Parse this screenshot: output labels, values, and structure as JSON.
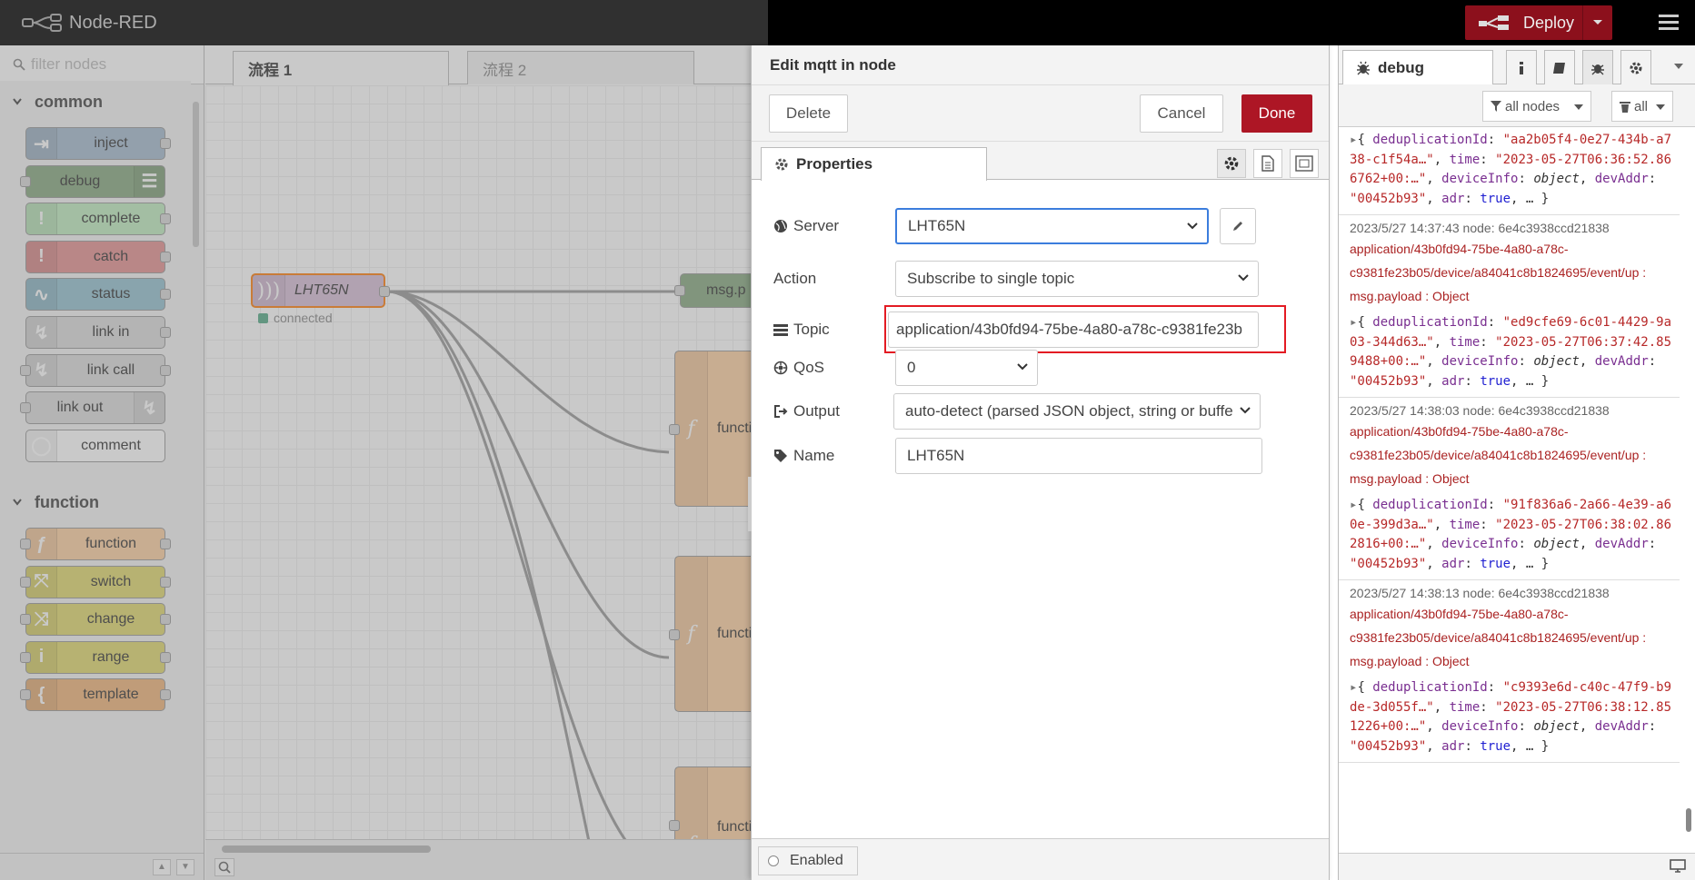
{
  "app": {
    "title": "Node-RED"
  },
  "header": {
    "deploy_label": "Deploy"
  },
  "palette": {
    "filter_placeholder": "filter nodes",
    "categories": [
      {
        "name": "common",
        "nodes": [
          {
            "label": "inject",
            "color": "#a6bbcf"
          },
          {
            "label": "debug",
            "color": "#87a980"
          },
          {
            "label": "complete",
            "color": "#c0edc0"
          },
          {
            "label": "catch",
            "color": "#e49191"
          },
          {
            "label": "status",
            "color": "#94c1d0"
          },
          {
            "label": "link in",
            "color": "#dddddd"
          },
          {
            "label": "link call",
            "color": "#dddddd"
          },
          {
            "label": "link out",
            "color": "#dddddd"
          },
          {
            "label": "comment",
            "color": "#ffffff"
          }
        ]
      },
      {
        "name": "function",
        "nodes": [
          {
            "label": "function",
            "color": "#fdd0a2"
          },
          {
            "label": "switch",
            "color": "#e2d96e"
          },
          {
            "label": "change",
            "color": "#e2d96e"
          },
          {
            "label": "range",
            "color": "#e2d96e"
          },
          {
            "label": "template",
            "color": "#f0b57b"
          }
        ]
      }
    ]
  },
  "workspace": {
    "tabs": [
      {
        "label": "流程 1",
        "active": true
      },
      {
        "label": "流程 2",
        "active": false
      }
    ],
    "nodes": {
      "mqtt_in": {
        "label": "LHT65N",
        "status": "connected",
        "color": "#d8bfd8"
      },
      "debug": {
        "label": "msg.p"
      },
      "functions": [
        {
          "label": "functi"
        },
        {
          "label": "functi"
        },
        {
          "label": "functi"
        }
      ]
    }
  },
  "editor": {
    "title": "Edit mqtt in node",
    "buttons": {
      "delete": "Delete",
      "cancel": "Cancel",
      "done": "Done"
    },
    "tab_properties": "Properties",
    "fields": {
      "server": {
        "label": "Server",
        "value": "LHT65N"
      },
      "action": {
        "label": "Action",
        "value": "Subscribe to single topic"
      },
      "topic": {
        "label": "Topic",
        "value": "application/43b0fd94-75be-4a80-a78c-c9381fe23b"
      },
      "qos": {
        "label": "QoS",
        "value": "0"
      },
      "output": {
        "label": "Output",
        "value": "auto-detect (parsed JSON object, string or buffe"
      },
      "name": {
        "label": "Name",
        "value": "LHT65N"
      }
    },
    "enabled_label": "Enabled",
    "highlight_color": "#e31b23"
  },
  "sidebar": {
    "tab_label": "debug",
    "filter_nodes_label": "all nodes",
    "clear_label": "all",
    "messages": [
      {
        "meta": "",
        "topic_lines": [],
        "payload": "",
        "obj": [
          {
            "k": "deduplicationId",
            "v": "\"aa2b05f4-0e27-434b-a738-c1f54a…\""
          },
          {
            "k": "time",
            "v": "\"2023-05-27T06:36:52.866762+00:…\""
          },
          {
            "k": "deviceInfo",
            "v": "object",
            "type": "i"
          },
          {
            "k": "devAddr",
            "v": "\"00452b93\""
          },
          {
            "k": "adr",
            "v": "true",
            "type": "b"
          }
        ]
      },
      {
        "meta": "2023/5/27 14:37:43   node: 6e4c3938ccd21838",
        "topic_lines": [
          "application/43b0fd94-75be-4a80-a78c-",
          "c9381fe23b05/device/a84041c8b1824695/event/up :",
          "msg.payload : Object"
        ],
        "obj": [
          {
            "k": "deduplicationId",
            "v": "\"ed9cfe69-6c01-4429-9a03-344d63…\""
          },
          {
            "k": "time",
            "v": "\"2023-05-27T06:37:42.859488+00:…\""
          },
          {
            "k": "deviceInfo",
            "v": "object",
            "type": "i"
          },
          {
            "k": "devAddr",
            "v": "\"00452b93\""
          },
          {
            "k": "adr",
            "v": "true",
            "type": "b"
          }
        ]
      },
      {
        "meta": "2023/5/27 14:38:03   node: 6e4c3938ccd21838",
        "topic_lines": [
          "application/43b0fd94-75be-4a80-a78c-",
          "c9381fe23b05/device/a84041c8b1824695/event/up :",
          "msg.payload : Object"
        ],
        "obj": [
          {
            "k": "deduplicationId",
            "v": "\"91f836a6-2a66-4e39-a60e-399d3a…\""
          },
          {
            "k": "time",
            "v": "\"2023-05-27T06:38:02.862816+00:…\""
          },
          {
            "k": "deviceInfo",
            "v": "object",
            "type": "i"
          },
          {
            "k": "devAddr",
            "v": "\"00452b93\""
          },
          {
            "k": "adr",
            "v": "true",
            "type": "b"
          }
        ]
      },
      {
        "meta": "2023/5/27 14:38:13   node: 6e4c3938ccd21838",
        "topic_lines": [
          "application/43b0fd94-75be-4a80-a78c-",
          "c9381fe23b05/device/a84041c8b1824695/event/up :",
          "msg.payload : Object"
        ],
        "obj": [
          {
            "k": "deduplicationId",
            "v": "\"c9393e6d-c40c-47f9-b9de-3d055f…\""
          },
          {
            "k": "time",
            "v": "\"2023-05-27T06:38:12.851226+00:…\""
          },
          {
            "k": "deviceInfo",
            "v": "object",
            "type": "i"
          },
          {
            "k": "devAddr",
            "v": "\"00452b93\""
          },
          {
            "k": "adr",
            "v": "true",
            "type": "b"
          }
        ]
      }
    ]
  }
}
